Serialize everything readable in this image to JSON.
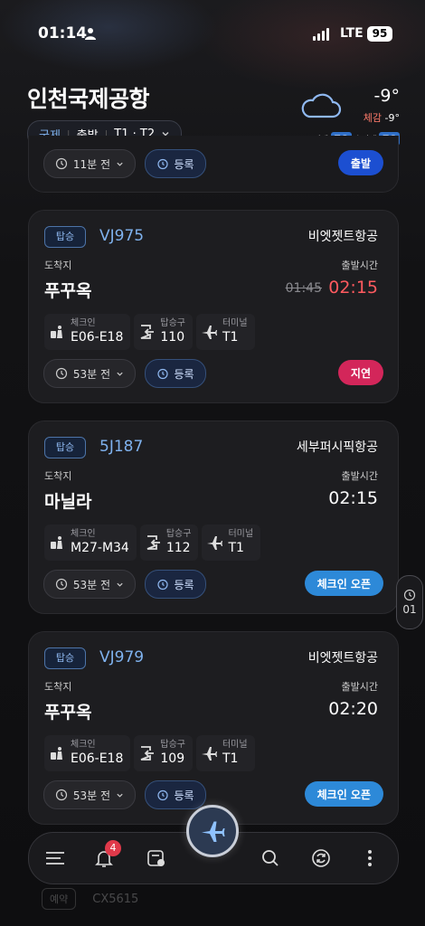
{
  "status_bar": {
    "time": "01:14",
    "network": "LTE",
    "battery": "95"
  },
  "header": {
    "title": "인천국제공항",
    "filter": {
      "region": "국제",
      "direction": "출발",
      "terminals": "T1 · T2"
    }
  },
  "weather": {
    "temp": "-9°",
    "feels_label": "체감",
    "feels_value": "-9°",
    "fine_dust_label": "미세",
    "fine_dust_value": "좋음",
    "ultra_fine_dust_label": "초미세",
    "ultra_fine_dust_value": "좋음"
  },
  "partial_card": {
    "time_ago": "11분 전",
    "register": "등록",
    "status": "출발"
  },
  "labels": {
    "destination": "도착지",
    "departure_time": "출발시간",
    "checkin": "체크인",
    "gate": "탑승구",
    "terminal": "터미널",
    "register": "등록",
    "board_type": "탑승"
  },
  "flights": [
    {
      "flight_no": "VJ975",
      "airline": "비엣젯트항공",
      "destination": "푸꾸옥",
      "old_time": "01:45",
      "time": "02:15",
      "checkin": "E06-E18",
      "gate": "110",
      "terminal": "T1",
      "time_ago": "53분 전",
      "status": "지연"
    },
    {
      "flight_no": "5J187",
      "airline": "세부퍼시픽항공",
      "destination": "마닐라",
      "time": "02:15",
      "checkin": "M27-M34",
      "gate": "112",
      "terminal": "T1",
      "time_ago": "53분 전",
      "status": "체크인 오픈"
    },
    {
      "flight_no": "VJ979",
      "airline": "비엣젯트항공",
      "destination": "푸꾸옥",
      "time": "02:20",
      "checkin": "E06-E18",
      "gate": "109",
      "terminal": "T1",
      "time_ago": "53분 전",
      "status": "체크인 오픈"
    }
  ],
  "side_tab": {
    "label": "01"
  },
  "bottom_nav": {
    "notification_count": "4"
  },
  "ghost_row": {
    "badge": "예약",
    "flight_no": "CX5615"
  }
}
